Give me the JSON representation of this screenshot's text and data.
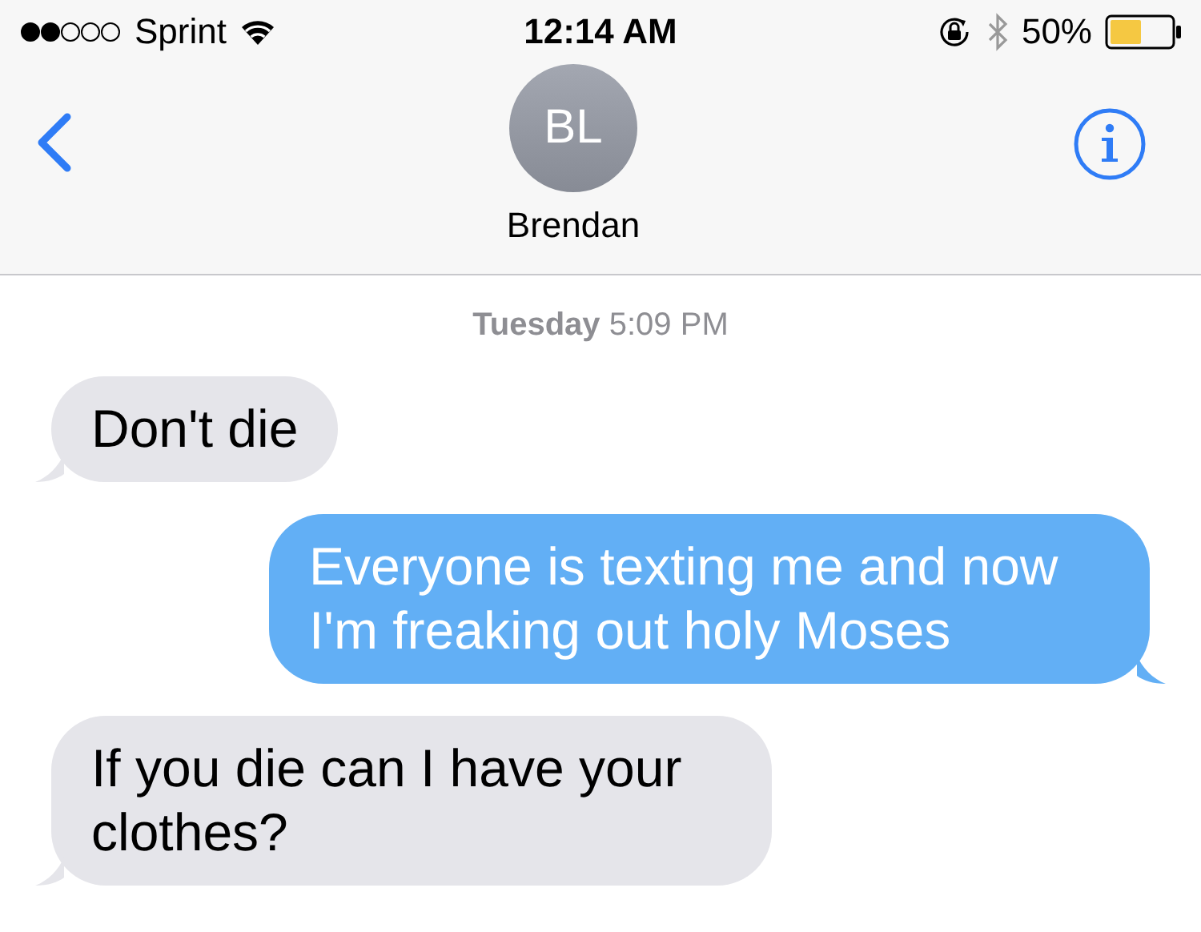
{
  "status_bar": {
    "carrier": "Sprint",
    "time": "12:14 AM",
    "battery": "50%"
  },
  "header": {
    "avatar_initials": "BL",
    "contact_name": "Brendan"
  },
  "timestamp": "**Tuesday** 5:09 PM",
  "messages": [
    {
      "kind": "incoming",
      "text": "Don't die"
    },
    {
      "kind": "outgoing",
      "text": "Everyone is texting me and now I'm freaking out holy Moses"
    },
    {
      "kind": "incoming",
      "text": "If you die can I have your clothes?"
    }
  ]
}
